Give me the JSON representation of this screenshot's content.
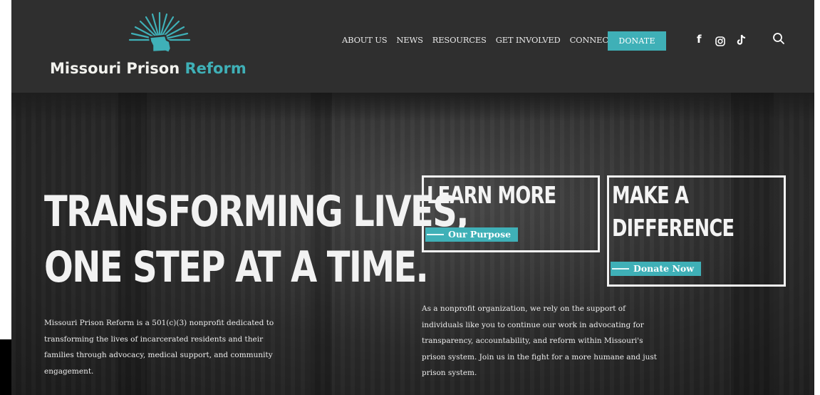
{
  "logo": {
    "text_white": "Missouri Prison",
    "text_teal": "Reform"
  },
  "nav": {
    "items": [
      "ABOUT US",
      "NEWS",
      "RESOURCES",
      "GET INVOLVED",
      "CONNECT"
    ],
    "donate_label": "DONATE",
    "social_icons": [
      "facebook-icon",
      "instagram-icon",
      "tiktok-icon"
    ],
    "search_icon": "search-icon"
  },
  "hero": {
    "headline_line1": "TRANSFORMING LIVES,",
    "headline_line2": "ONE STEP AT A TIME.",
    "intro_text": "Missouri Prison Reform is a 501(c)(3) nonprofit dedicated to transforming the lives of incarcerated residents and their families through advocacy, medical support, and community engagement.",
    "learn_box": {
      "title": "LEARN MORE",
      "button": "Our Purpose"
    },
    "difference_box": {
      "title_line1": "MAKE A",
      "title_line2": "DIFFERENCE",
      "button": "Donate Now"
    },
    "support_text": "As a nonprofit organization, we rely on the support of individuals like you to continue our work in advocating for transparency, accountability, and reform within Missouri's prison system. Join us in the fight for a more humane and just prison system."
  },
  "colors": {
    "accent": "#3fb0b7",
    "header_bg": "#2f2f2f",
    "hero_bg": "#2a2a2a",
    "text": "#f2f2f2"
  }
}
